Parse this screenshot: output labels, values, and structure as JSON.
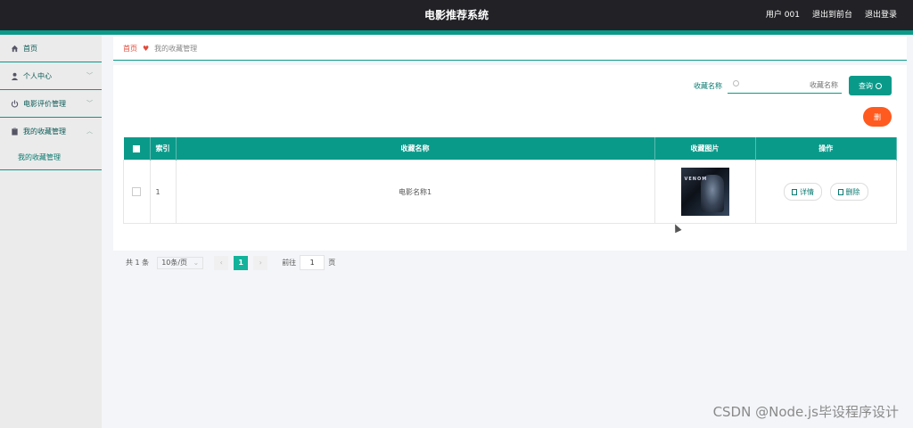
{
  "header": {
    "title": "电影推荐系统",
    "user": "用户 001",
    "link_front": "退出到前台",
    "link_logout": "退出登录"
  },
  "sidebar": {
    "items": [
      {
        "label": "首页",
        "icon": "home-icon"
      },
      {
        "label": "个人中心",
        "icon": "user-icon"
      },
      {
        "label": "电影评价管理",
        "icon": "power-icon"
      },
      {
        "label": "我的收藏管理",
        "icon": "clipboard-icon"
      }
    ],
    "sub_items": [
      {
        "label": "我的收藏管理"
      }
    ]
  },
  "breadcrumb": {
    "home": "首页",
    "current": "我的收藏管理"
  },
  "search": {
    "label": "收藏名称",
    "placeholder": "收藏名称",
    "button": "查询"
  },
  "delete_button": "删",
  "table": {
    "headers": [
      "索引",
      "收藏名称",
      "收藏图片",
      "操作"
    ],
    "rows": [
      {
        "index": "1",
        "name": "电影名称1",
        "poster_text": "VENOM"
      }
    ],
    "actions": {
      "detail": "详情",
      "delete": "删除"
    }
  },
  "pager": {
    "total": "共 1 条",
    "page_size": "10条/页",
    "prev": "‹",
    "current_page": "1",
    "next": "›",
    "goto_label": "前往",
    "goto_value": "1",
    "goto_suffix": "页"
  },
  "watermark": "CSDN @Node.js毕设程序设计",
  "colors": {
    "primary": "#0a9a8a",
    "topbar": "#222226",
    "danger": "#ff5a1f",
    "breadcrumb": "#e04a3a"
  }
}
